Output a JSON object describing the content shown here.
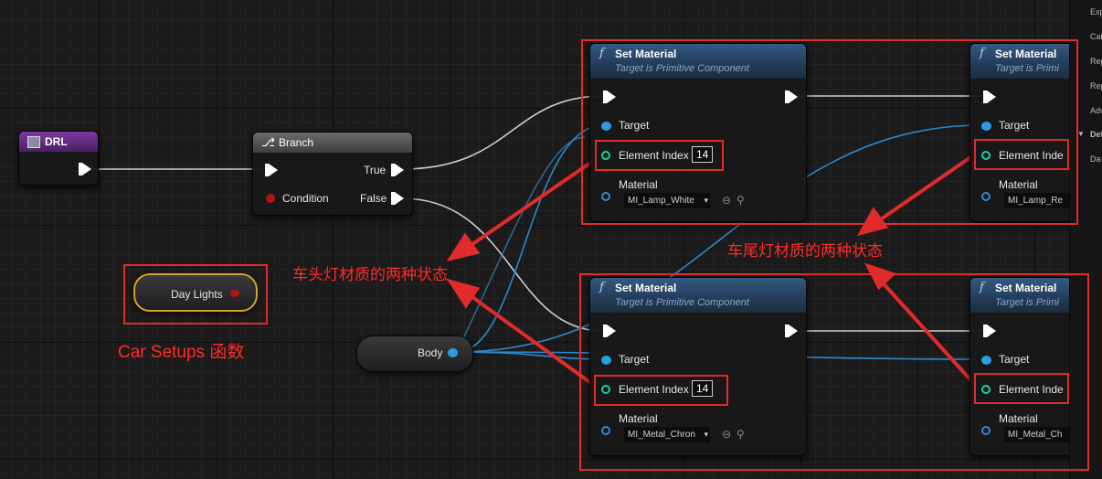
{
  "nodes": {
    "drl": {
      "title": "DRL"
    },
    "branch": {
      "title": "Branch",
      "true_label": "True",
      "false_label": "False",
      "condition_label": "Condition"
    },
    "day_lights": {
      "label": "Day Lights"
    },
    "body": {
      "label": "Body"
    },
    "set_material_front_1": {
      "title": "Set Material",
      "subtitle": "Target is Primitive Component",
      "target_label": "Target",
      "element_index_label": "Element Index",
      "element_index_value": "14",
      "material_label": "Material",
      "material_value": "MI_Lamp_White"
    },
    "set_material_front_2": {
      "title": "Set Material",
      "subtitle": "Target is Primitive Component",
      "target_label": "Target",
      "element_index_label": "Element Index",
      "element_index_value": "14",
      "material_label": "Material",
      "material_value": "MI_Metal_Chron"
    },
    "set_material_rear_1": {
      "title": "Set Material",
      "subtitle": "Target is Primi",
      "target_label": "Target",
      "element_index_label": "Element Inde",
      "material_label": "Material",
      "material_value": "MI_Lamp_Re"
    },
    "set_material_rear_2": {
      "title": "Set Material",
      "subtitle": "Target is Primi",
      "target_label": "Target",
      "element_index_label": "Element Inde",
      "material_label": "Material",
      "material_value": "MI_Metal_Ch"
    }
  },
  "annotations": {
    "front_light": "车头灯材质的两种状态",
    "rear_light": "车尾灯材质的两种状态",
    "car_setups": "Car Setups 函数"
  },
  "details_panel": {
    "items": [
      "Exp",
      "Cal",
      "Rep",
      "Rep",
      "Adv",
      "Def",
      "Da"
    ]
  },
  "colors": {
    "annotation_red": "#e12b2b",
    "exec_wire": "#dddddd",
    "object_wire": "#2f9cdf",
    "function_header": "#2b4a6b",
    "branch_header": "#5a5a5a",
    "drl_header": "#6b2f8a"
  }
}
